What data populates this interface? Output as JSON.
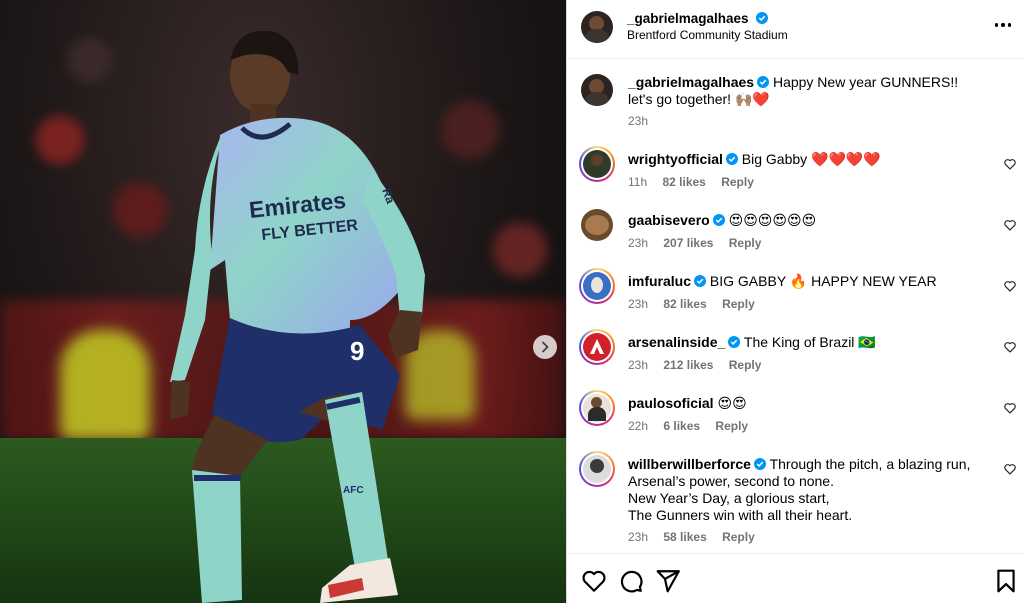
{
  "post_header": {
    "username": "_gabrielmagalhaes",
    "location": "Brentford Community Stadium"
  },
  "photo": {
    "jersey_sponsor_line1": "Emirates",
    "jersey_sponsor_line2": "FLY BETTER",
    "jersey_number": "9",
    "sock_text": "AFC",
    "sleeve_text": "Ra",
    "icon": "chevron-right-icon"
  },
  "caption": {
    "username": "_gabrielmagalhaes",
    "text": "Happy New year GUNNERS!! let's go together! 🙌🏽❤️",
    "time": "23h"
  },
  "comments": [
    {
      "username": "wrightyofficial",
      "verified": true,
      "text": "Big Gabby ❤️❤️❤️❤️",
      "time": "11h",
      "likes": "82 likes",
      "reply": "Reply",
      "avatar_color": "#2e3b2b"
    },
    {
      "username": "gaabisevero",
      "verified": true,
      "text": "😍😍😍😍😍😍",
      "time": "23h",
      "likes": "207 likes",
      "reply": "Reply",
      "avatar_color": "#6b4a2c"
    },
    {
      "username": "imfuraluc",
      "verified": true,
      "text": "BIG GABBY 🔥 HAPPY NEW YEAR",
      "time": "23h",
      "likes": "82 likes",
      "reply": "Reply",
      "avatar_color": "#3a6fc4"
    },
    {
      "username": "arsenalinside_",
      "verified": true,
      "text": "The King of Brazil 🇧🇷",
      "time": "23h",
      "likes": "212 likes",
      "reply": "Reply",
      "avatar_color": "#d0202a"
    },
    {
      "username": "paulosoficial",
      "verified": false,
      "text": "😍😍",
      "time": "22h",
      "likes": "6 likes",
      "reply": "Reply",
      "avatar_color": "#c9b8a8"
    },
    {
      "username": "willberwillberforce",
      "verified": true,
      "text": "Through the pitch, a blazing run,",
      "text_lines": [
        "Arsenal’s power, second to none.",
        "New Year’s Day, a glorious start,",
        "The Gunners win with all their heart."
      ],
      "time": "23h",
      "likes": "58 likes",
      "reply": "Reply",
      "avatar_color": "#8a8a8a"
    }
  ],
  "action_icons": [
    "heart-icon",
    "comment-icon",
    "share-icon",
    "bookmark-icon"
  ],
  "colors": {
    "verified": "#0095f6",
    "meta_text": "#737373",
    "jersey": "#8fd4c8"
  }
}
